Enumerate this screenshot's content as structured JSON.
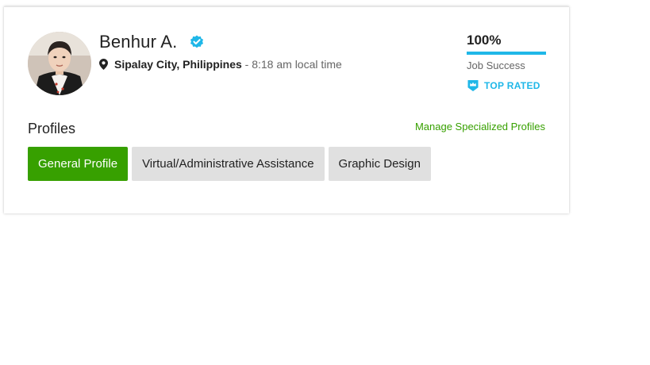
{
  "colors": {
    "accent_green": "#37a000",
    "top_rated_blue": "#1fb7e8",
    "verified_blue": "#1fb7e8",
    "tab_inactive_bg": "#e0e0e0"
  },
  "profile": {
    "name": "Benhur A.",
    "verified_icon": "verified-badge-icon",
    "location_icon": "map-pin-icon",
    "location": "Sipalay City, Philippines",
    "local_time": " - 8:18 am local time"
  },
  "stats": {
    "job_success_value": "100%",
    "job_success_fraction": 1.0,
    "job_success_label": "Job Success",
    "top_rated_icon": "top-rated-badge-icon",
    "top_rated_label": "TOP RATED"
  },
  "profiles": {
    "heading": "Profiles",
    "manage_link": "Manage Specialized Profiles",
    "tabs": [
      {
        "label": "General Profile",
        "active": true
      },
      {
        "label": "Virtual/Administrative Assistance",
        "active": false
      },
      {
        "label": "Graphic Design",
        "active": false
      }
    ]
  }
}
